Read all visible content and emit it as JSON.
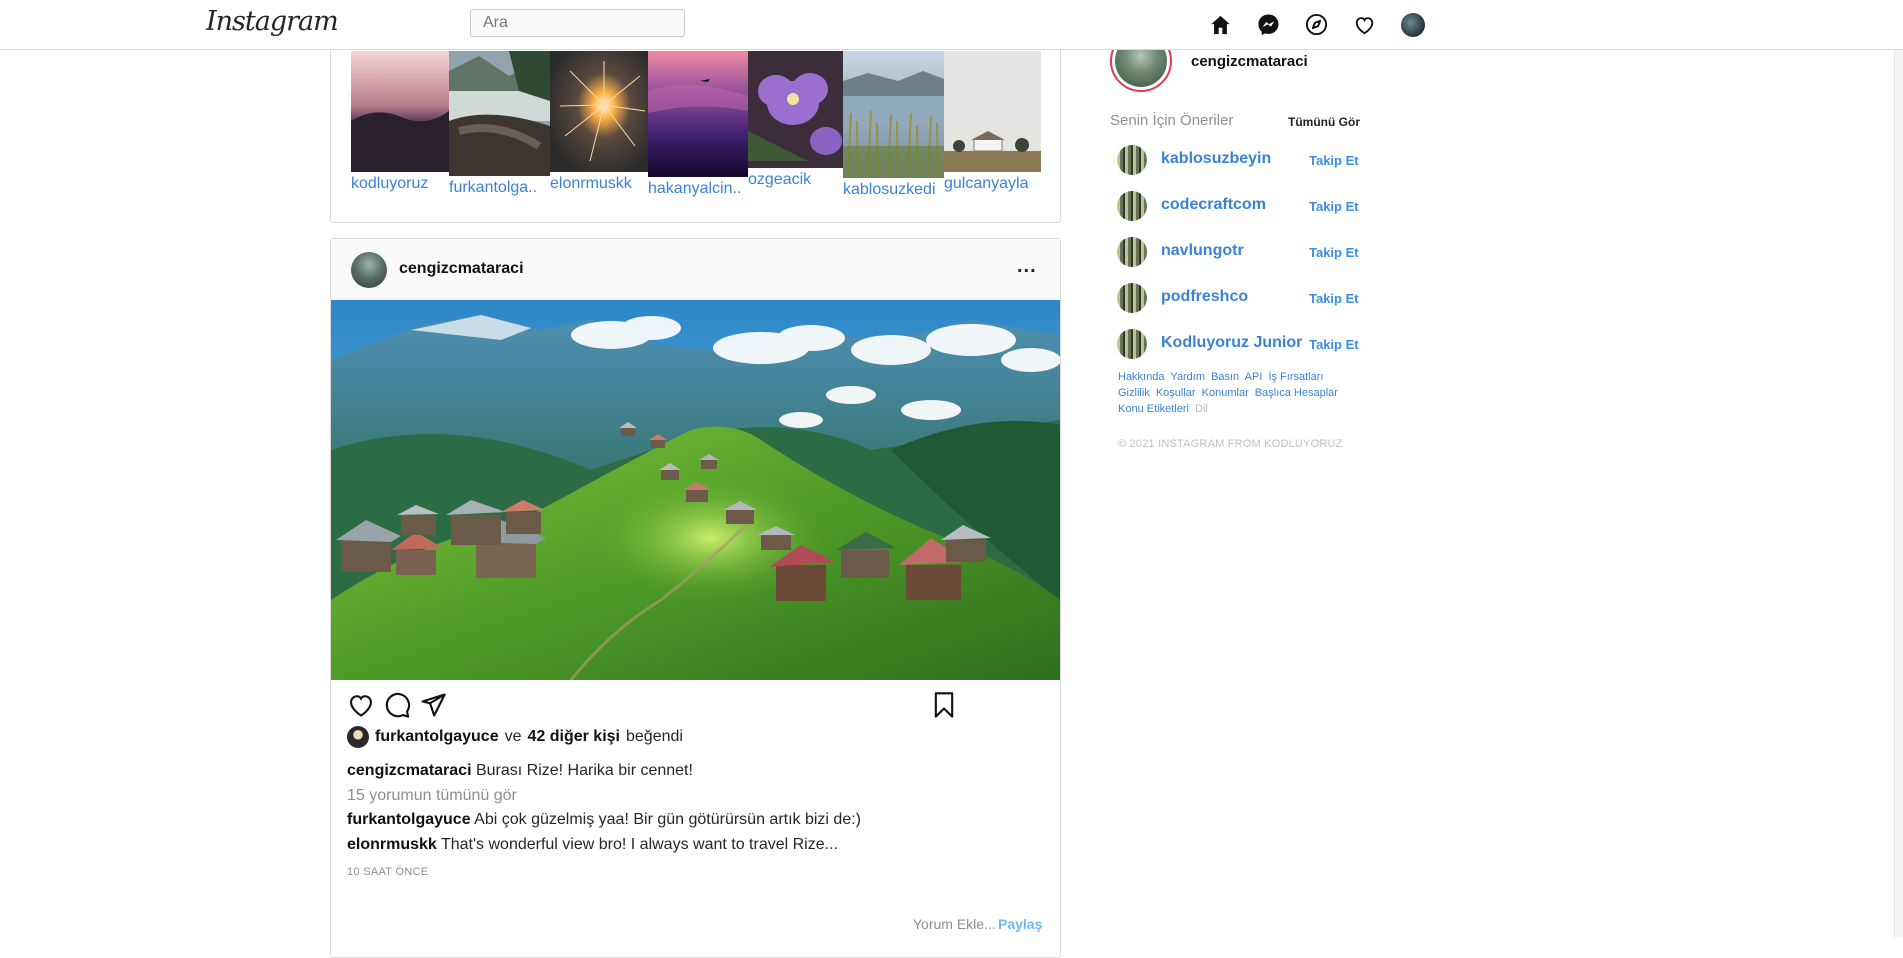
{
  "nav": {
    "logo": "Instagram",
    "search_placeholder": "Ara",
    "icons": [
      "home-icon",
      "messenger-icon",
      "explore-icon",
      "heart-icon",
      "profile-avatar"
    ]
  },
  "stories": [
    {
      "username": "kodluyoruz",
      "scene": "purple sunset over mountains"
    },
    {
      "username": "furkantolga..",
      "scene": "mountain river with rocks"
    },
    {
      "username": "elonrmuskk",
      "scene": "sparkler firework"
    },
    {
      "username": "hakanyalcin..",
      "scene": "purple sky with plane"
    },
    {
      "username": "ozgeacik",
      "scene": "purple petunia flowers"
    },
    {
      "username": "kablosuzkedi",
      "scene": "lake with reeds"
    },
    {
      "username": "gulcanyayla",
      "scene": "house in foggy field"
    }
  ],
  "post": {
    "username": "cengizcmataraci",
    "more_label": "...",
    "image_scene": "green highland plateau with wooden houses (Rize)",
    "likes": {
      "liker": "furkantolgayuce",
      "connector": "ve",
      "others": "42 diğer kişi",
      "suffix": "beğendi"
    },
    "caption": {
      "user": "cengizcmataraci",
      "text": "Burası Rize! Harika bir cennet!"
    },
    "view_all_comments": "15 yorumun tümünü gör",
    "comments": [
      {
        "user": "furkantolgayuce",
        "text": "Abi çok güzelmiş yaa! Bir gün götürürsün artık bizi de:)"
      },
      {
        "user": "elonrmuskk",
        "text": "That's wonderful view bro! I always want to travel Rize..."
      }
    ],
    "time": "10 SAAT ÖNCE",
    "add_comment_placeholder": "Yorum Ekle...",
    "share_label": "Paylaş"
  },
  "sidebar": {
    "username": "cengizcmataraci",
    "suggestions_title": "Senin İçin Öneriler",
    "see_all": "Tümünü Gör",
    "suggestions": [
      {
        "username": "kablosuzbeyin",
        "follow": "Takip Et"
      },
      {
        "username": "codecraftcom",
        "follow": "Takip Et"
      },
      {
        "username": "navlungotr",
        "follow": "Takip Et"
      },
      {
        "username": "podfreshco",
        "follow": "Takip Et"
      },
      {
        "username": "Kodluyoruz Junior",
        "follow": "Takip Et"
      }
    ],
    "footer_links": [
      "Hakkında",
      "Yardım",
      "Basın",
      "API",
      "İş Fırsatları",
      "Gizlilik",
      "Koşullar",
      "Konumlar",
      "Başlıca Hesaplar",
      "Konu Etiketleri",
      "Dil"
    ],
    "copyright": "© 2021 INSTAGRAM FROM KODLUYORUZ"
  },
  "colors": {
    "link": "#3a82d6",
    "follow": "#3a8ee6",
    "share": "#6eb7ee",
    "story_ring": "#e03a52",
    "border": "#dbdbdb"
  }
}
